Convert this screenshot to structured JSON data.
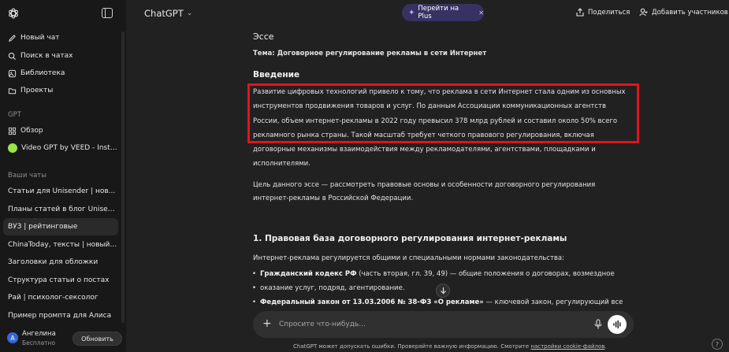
{
  "sidebar": {
    "new_chat": "Новый чат",
    "search_chats": "Поиск в чатах",
    "library": "Библиотека",
    "projects": "Проекты",
    "gpt_section": "GPT",
    "explore": "Обзор",
    "video_gpt": "Video GPT by VEED - Instant...",
    "chats_section": "Ваши чаты",
    "chats": [
      "Статьи для Unisender | нов...",
      "Планы статей в блог Unisen...",
      "ВУЗ | рейтинговые",
      "ChinaToday, тексты | новый ...",
      "Заголовки для обложки",
      "Структура статьи о постах",
      "Рай | психолог-сексолог",
      "Пример промпта для Алиса"
    ],
    "user": {
      "avatar_letter": "А",
      "name": "Ангелина",
      "plan": "Бесплатно",
      "upgrade": "Обновить"
    }
  },
  "header": {
    "model": "ChatGPT",
    "plus_pill": "Перейти на Plus",
    "share": "Поделиться",
    "add_people": "Добавить участников"
  },
  "message": {
    "essay_title": "Эссе",
    "topic": "Тема: Договорное регулирование рекламы в сети Интернет",
    "intro_heading": "Введение",
    "intro_lines": [
      "Развитие цифровых технологий привело к тому, что реклама в сети Интернет стала одним из основных",
      "инструментов продвижения товаров и услуг. По данным Ассоциации коммуникационных агентств",
      "России, объем интернет-рекламы в 2022 году превысил 378 млрд рублей и составил около 50% всего",
      "рекламного рынка страны. Такой масштаб требует четкого правового регулирования, включая",
      "договорные механизмы взаимодействия между рекламодателями, агентствами, площадками и",
      "исполнителями."
    ],
    "goal_lines": [
      "Цель данного эссе — рассмотреть правовые основы и особенности договорного регулирования",
      "интернет-рекламы в Российской Федерации."
    ],
    "section1_heading": "1. Правовая база договорного регулирования интернет-рекламы",
    "section1_intro": "Интернет-реклама регулируется общими и специальными нормами законодательства:",
    "bullet1_bold": "Гражданский кодекс РФ",
    "bullet1_rest": " (часть вторая, гл. 39, 49) — общие положения о договорах, возмездное",
    "bullet1_line2": "оказание услуг, подряд, агентирование.",
    "bullet2_bold": "Федеральный закон от 13.03.2006 № 38-ФЗ «О рекламе»",
    "bullet2_rest": " — ключевой закон, регулирующий все"
  },
  "composer": {
    "placeholder": "Спросите что-нибудь..."
  },
  "footer": {
    "disclaimer": "ChatGPT может допускать ошибки. Проверяйте важную информацию. Смотрите ",
    "link": "настройки cookie-файлов",
    "end": ".",
    "help": "?"
  },
  "colors": {
    "highlight_border": "#e3141b",
    "plus_pill": "#373262",
    "background": "#212121",
    "sidebar": "#181818"
  }
}
